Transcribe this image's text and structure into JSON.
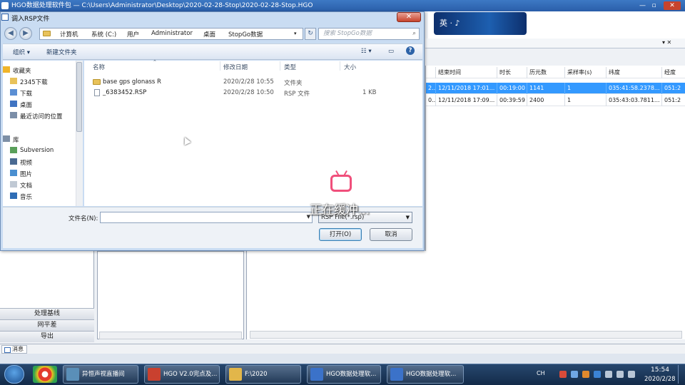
{
  "app": {
    "title": "HGO数据处理软件包 — C:\\Users\\Administrator\\Desktop\\2020-02-28-Stop\\2020-02-28-Stop.HGO",
    "banner_text": "英 · ♪",
    "tab_close": "▾ ✕",
    "win_minimize": "—",
    "win_restore": "▫",
    "win_close": "✕",
    "nav_buttons": [
      "处理基线",
      "网平差",
      "导出"
    ],
    "status_tab": "消息",
    "grid": {
      "columns": [
        "",
        "结束时间",
        "时长",
        "历元数",
        "采样率(s)",
        "纬度",
        "经度"
      ],
      "rows": [
        {
          "selected": true,
          "cells": [
            "2...",
            "12/11/2018 17:01...",
            "00:19:00",
            "1141",
            "1",
            "035:41:58.2378...",
            "051:2"
          ]
        },
        {
          "selected": false,
          "cells": [
            "0...",
            "12/11/2018 17:09...",
            "00:39:59",
            "2400",
            "1",
            "035:43:03.7811...",
            "051:2"
          ]
        }
      ]
    }
  },
  "dialog": {
    "title": "调入RSP文件",
    "close_label": "✕",
    "back_label": "◀",
    "forward_label": "▶",
    "address_crumbs": [
      "计算机",
      "系统 (C:)",
      "用户",
      "Administrator",
      "桌面",
      "StopGo数据"
    ],
    "refresh_label": "↻",
    "search_placeholder": "搜索 StopGo数据",
    "toolbar": {
      "organize": "组织 ▾",
      "new_folder": "新建文件夹",
      "view": "☷ ▾",
      "pane": "▭",
      "help": "?"
    },
    "tree": [
      {
        "label": "收藏夹",
        "icon": "star-icon"
      },
      {
        "label": "2345下载",
        "icon": "folder-icon"
      },
      {
        "label": "下载",
        "icon": "download-folder-icon"
      },
      {
        "label": "桌面",
        "icon": "desktop-icon"
      },
      {
        "label": "最近访问的位置",
        "icon": "recent-places-icon"
      },
      {
        "label": "库",
        "icon": "library-icon"
      },
      {
        "label": "Subversion",
        "icon": "subversion-icon"
      },
      {
        "label": "视频",
        "icon": "video-icon"
      },
      {
        "label": "图片",
        "icon": "pictures-icon"
      },
      {
        "label": "文档",
        "icon": "documents-icon"
      },
      {
        "label": "音乐",
        "icon": "music-icon"
      }
    ],
    "columns": {
      "name": "名称",
      "modified": "修改日期",
      "type": "类型",
      "size": "大小"
    },
    "files": [
      {
        "name": "base gps glonass R",
        "modified": "2020/2/28 10:55",
        "type": "文件夹",
        "size": ""
      },
      {
        "name": "_6383452.RSP",
        "modified": "2020/2/28 10:50",
        "type": "RSP 文件",
        "size": "1 KB"
      }
    ],
    "filename_label": "文件名(N):",
    "filename_value": "",
    "filetype_value": "RSP File(*.rsp)",
    "open_label": "打开(O)",
    "cancel_label": "取消"
  },
  "overlay": {
    "buffering_text": "正在缓冲..."
  },
  "taskbar": {
    "tasks": [
      {
        "label": "异恒声视直播间"
      },
      {
        "label": "HGO V2.0完点及..."
      },
      {
        "label": "F:\\2020"
      },
      {
        "label": "HGO数据处理软..."
      },
      {
        "label": "HGO数据处理软..."
      }
    ],
    "ime": "CH",
    "time": "15:54",
    "date": "2020/2/28"
  },
  "colors": {
    "accent": "#3399ff",
    "title_bar": "#2a5ea9",
    "dialog_frame": "#c9dcf2",
    "buffer_icon": "#f04f7b"
  }
}
